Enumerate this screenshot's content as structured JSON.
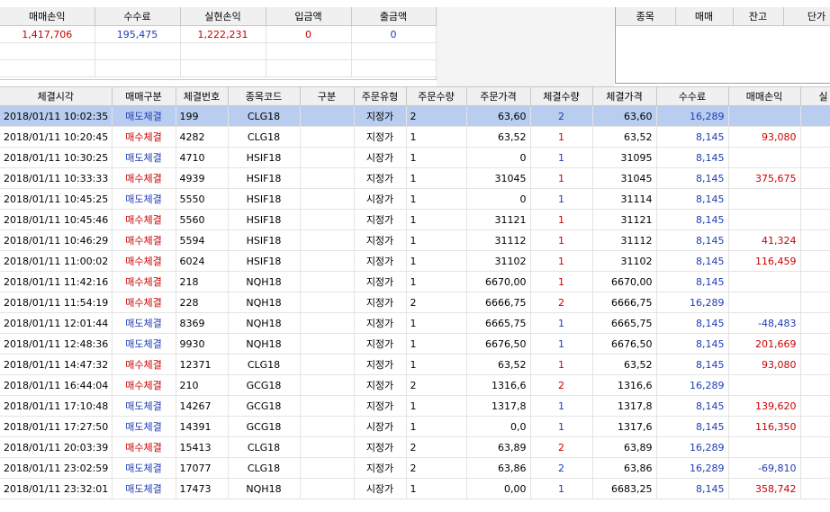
{
  "summary": {
    "headers": [
      "매매손익",
      "수수료",
      "실현손익",
      "입금액",
      "출금액"
    ],
    "values": [
      "1,417,706",
      "195,475",
      "1,222,231",
      "0",
      "0"
    ]
  },
  "positions": {
    "headers": [
      "종목",
      "매매",
      "잔고",
      "단가"
    ]
  },
  "trades": {
    "headers": [
      "체결시각",
      "매매구분",
      "체결번호",
      "종목코드",
      "구분",
      "주문유형",
      "주문수량",
      "주문가격",
      "체결수량",
      "체결가격",
      "수수료",
      "매매손익",
      "실"
    ],
    "rows": [
      {
        "time": "2018/01/11 10:02:35",
        "side": "매도체결",
        "side_type": "sell",
        "no": "199",
        "code": "CLG18",
        "kind": "",
        "order_type": "지정가",
        "order_qty": "2",
        "order_price": "63,60",
        "fill_qty": "2",
        "fill_price": "63,60",
        "fee": "16,289",
        "pnl": "",
        "pnl_sign": ""
      },
      {
        "time": "2018/01/11 10:20:45",
        "side": "매수체결",
        "side_type": "buy",
        "no": "4282",
        "code": "CLG18",
        "kind": "",
        "order_type": "지정가",
        "order_qty": "1",
        "order_price": "63,52",
        "fill_qty": "1",
        "fill_price": "63,52",
        "fee": "8,145",
        "pnl": "93,080",
        "pnl_sign": "pos"
      },
      {
        "time": "2018/01/11 10:30:25",
        "side": "매도체결",
        "side_type": "sell",
        "no": "4710",
        "code": "HSIF18",
        "kind": "",
        "order_type": "시장가",
        "order_qty": "1",
        "order_price": "0",
        "fill_qty": "1",
        "fill_price": "31095",
        "fee": "8,145",
        "pnl": "",
        "pnl_sign": ""
      },
      {
        "time": "2018/01/11 10:33:33",
        "side": "매수체결",
        "side_type": "buy",
        "no": "4939",
        "code": "HSIF18",
        "kind": "",
        "order_type": "지정가",
        "order_qty": "1",
        "order_price": "31045",
        "fill_qty": "1",
        "fill_price": "31045",
        "fee": "8,145",
        "pnl": "375,675",
        "pnl_sign": "pos"
      },
      {
        "time": "2018/01/11 10:45:25",
        "side": "매도체결",
        "side_type": "sell",
        "no": "5550",
        "code": "HSIF18",
        "kind": "",
        "order_type": "시장가",
        "order_qty": "1",
        "order_price": "0",
        "fill_qty": "1",
        "fill_price": "31114",
        "fee": "8,145",
        "pnl": "",
        "pnl_sign": ""
      },
      {
        "time": "2018/01/11 10:45:46",
        "side": "매수체결",
        "side_type": "buy",
        "no": "5560",
        "code": "HSIF18",
        "kind": "",
        "order_type": "지정가",
        "order_qty": "1",
        "order_price": "31121",
        "fill_qty": "1",
        "fill_price": "31121",
        "fee": "8,145",
        "pnl": "",
        "pnl_sign": ""
      },
      {
        "time": "2018/01/11 10:46:29",
        "side": "매수체결",
        "side_type": "buy",
        "no": "5594",
        "code": "HSIF18",
        "kind": "",
        "order_type": "지정가",
        "order_qty": "1",
        "order_price": "31112",
        "fill_qty": "1",
        "fill_price": "31112",
        "fee": "8,145",
        "pnl": "41,324",
        "pnl_sign": "pos"
      },
      {
        "time": "2018/01/11 11:00:02",
        "side": "매수체결",
        "side_type": "buy",
        "no": "6024",
        "code": "HSIF18",
        "kind": "",
        "order_type": "지정가",
        "order_qty": "1",
        "order_price": "31102",
        "fill_qty": "1",
        "fill_price": "31102",
        "fee": "8,145",
        "pnl": "116,459",
        "pnl_sign": "pos"
      },
      {
        "time": "2018/01/11 11:42:16",
        "side": "매수체결",
        "side_type": "buy",
        "no": "218",
        "code": "NQH18",
        "kind": "",
        "order_type": "지정가",
        "order_qty": "1",
        "order_price": "6670,00",
        "fill_qty": "1",
        "fill_price": "6670,00",
        "fee": "8,145",
        "pnl": "",
        "pnl_sign": ""
      },
      {
        "time": "2018/01/11 11:54:19",
        "side": "매수체결",
        "side_type": "buy",
        "no": "228",
        "code": "NQH18",
        "kind": "",
        "order_type": "지정가",
        "order_qty": "2",
        "order_price": "6666,75",
        "fill_qty": "2",
        "fill_price": "6666,75",
        "fee": "16,289",
        "pnl": "",
        "pnl_sign": ""
      },
      {
        "time": "2018/01/11 12:01:44",
        "side": "매도체결",
        "side_type": "sell",
        "no": "8369",
        "code": "NQH18",
        "kind": "",
        "order_type": "지정가",
        "order_qty": "1",
        "order_price": "6665,75",
        "fill_qty": "1",
        "fill_price": "6665,75",
        "fee": "8,145",
        "pnl": "-48,483",
        "pnl_sign": "neg"
      },
      {
        "time": "2018/01/11 12:48:36",
        "side": "매도체결",
        "side_type": "sell",
        "no": "9930",
        "code": "NQH18",
        "kind": "",
        "order_type": "지정가",
        "order_qty": "1",
        "order_price": "6676,50",
        "fill_qty": "1",
        "fill_price": "6676,50",
        "fee": "8,145",
        "pnl": "201,669",
        "pnl_sign": "pos"
      },
      {
        "time": "2018/01/11 14:47:32",
        "side": "매수체결",
        "side_type": "buy",
        "no": "12371",
        "code": "CLG18",
        "kind": "",
        "order_type": "지정가",
        "order_qty": "1",
        "order_price": "63,52",
        "fill_qty": "1",
        "fill_price": "63,52",
        "fee": "8,145",
        "pnl": "93,080",
        "pnl_sign": "pos"
      },
      {
        "time": "2018/01/11 16:44:04",
        "side": "매수체결",
        "side_type": "buy",
        "no": "210",
        "code": "GCG18",
        "kind": "",
        "order_type": "지정가",
        "order_qty": "2",
        "order_price": "1316,6",
        "fill_qty": "2",
        "fill_price": "1316,6",
        "fee": "16,289",
        "pnl": "",
        "pnl_sign": ""
      },
      {
        "time": "2018/01/11 17:10:48",
        "side": "매도체결",
        "side_type": "sell",
        "no": "14267",
        "code": "GCG18",
        "kind": "",
        "order_type": "지정가",
        "order_qty": "1",
        "order_price": "1317,8",
        "fill_qty": "1",
        "fill_price": "1317,8",
        "fee": "8,145",
        "pnl": "139,620",
        "pnl_sign": "pos"
      },
      {
        "time": "2018/01/11 17:27:50",
        "side": "매도체결",
        "side_type": "sell",
        "no": "14391",
        "code": "GCG18",
        "kind": "",
        "order_type": "시장가",
        "order_qty": "1",
        "order_price": "0,0",
        "fill_qty": "1",
        "fill_price": "1317,6",
        "fee": "8,145",
        "pnl": "116,350",
        "pnl_sign": "pos"
      },
      {
        "time": "2018/01/11 20:03:39",
        "side": "매수체결",
        "side_type": "buy",
        "no": "15413",
        "code": "CLG18",
        "kind": "",
        "order_type": "지정가",
        "order_qty": "2",
        "order_price": "63,89",
        "fill_qty": "2",
        "fill_price": "63,89",
        "fee": "16,289",
        "pnl": "",
        "pnl_sign": ""
      },
      {
        "time": "2018/01/11 23:02:59",
        "side": "매도체결",
        "side_type": "sell",
        "no": "17077",
        "code": "CLG18",
        "kind": "",
        "order_type": "지정가",
        "order_qty": "2",
        "order_price": "63,86",
        "fill_qty": "2",
        "fill_price": "63,86",
        "fee": "16,289",
        "pnl": "-69,810",
        "pnl_sign": "neg"
      },
      {
        "time": "2018/01/11 23:32:01",
        "side": "매도체결",
        "side_type": "sell",
        "no": "17473",
        "code": "NQH18",
        "kind": "",
        "order_type": "시장가",
        "order_qty": "1",
        "order_price": "0,00",
        "fill_qty": "1",
        "fill_price": "6683,25",
        "fee": "8,145",
        "pnl": "358,742",
        "pnl_sign": "pos"
      }
    ]
  },
  "colors": {
    "buy": "#cc0000",
    "sell": "#1e3cb4",
    "selected_row": "#b9cdf0",
    "header_bg": "#f0f0f0"
  }
}
